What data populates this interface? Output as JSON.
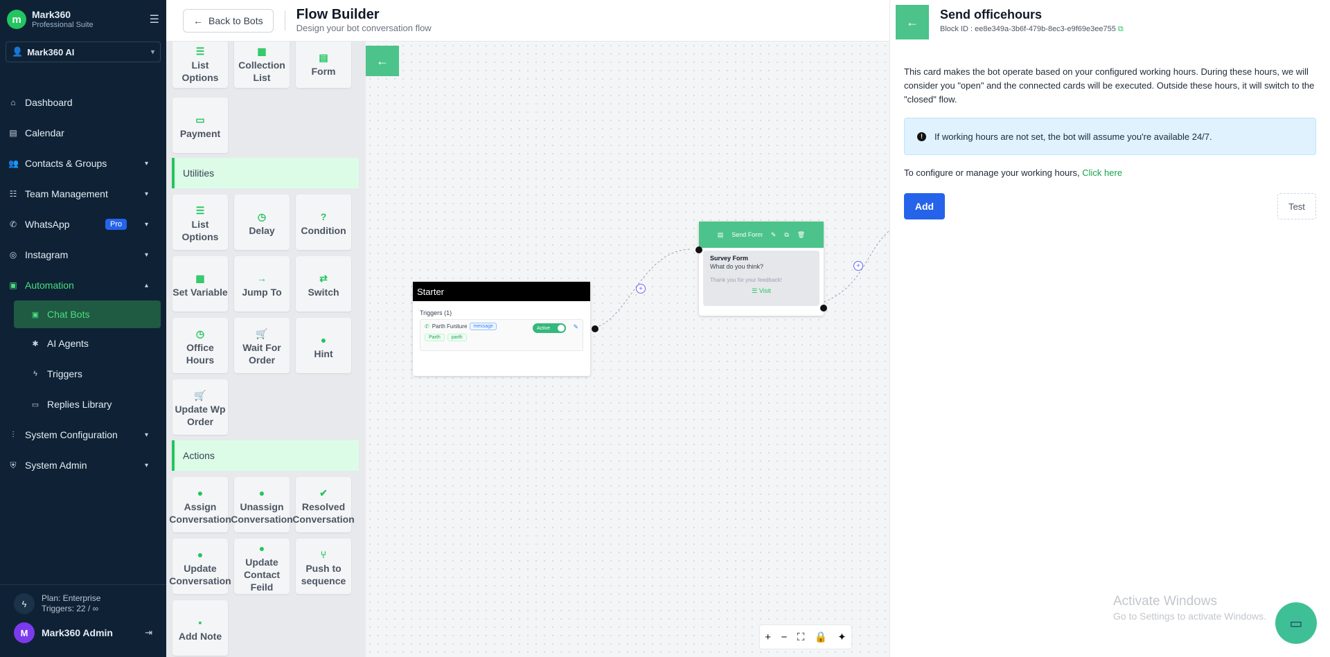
{
  "sidebar": {
    "brand": {
      "name": "Mark360",
      "subtitle": "Professional Suite",
      "logo_glyph": "m"
    },
    "workspace": "Mark360 AI",
    "items": [
      {
        "label": "Dashboard",
        "icon": "home-icon"
      },
      {
        "label": "Calendar",
        "icon": "calendar-icon"
      },
      {
        "label": "Contacts & Groups",
        "icon": "users-icon"
      },
      {
        "label": "Team Management",
        "icon": "team-icon"
      },
      {
        "label": "WhatsApp",
        "icon": "whatsapp-icon",
        "badge": "Pro"
      },
      {
        "label": "Instagram",
        "icon": "instagram-icon"
      },
      {
        "label": "Automation",
        "icon": "monitor-icon"
      },
      {
        "label": "System Configuration",
        "icon": "sliders-icon"
      },
      {
        "label": "System Admin",
        "icon": "shield-icon"
      }
    ],
    "sub_items": [
      {
        "label": "Chat Bots",
        "icon": "monitor-icon"
      },
      {
        "label": "AI Agents",
        "icon": "sparkle-icon"
      },
      {
        "label": "Triggers",
        "icon": "bolt-icon"
      },
      {
        "label": "Replies Library",
        "icon": "chat-icon"
      }
    ],
    "footer": {
      "plan": "Plan: Enterprise",
      "triggers": "Triggers: 22 / ∞",
      "user": "Mark360 Admin",
      "avatar": "M"
    }
  },
  "header": {
    "back_label": "Back to Bots",
    "title": "Flow Builder",
    "subtitle": "Design your bot conversation flow"
  },
  "palette": {
    "top_tiles": [
      "List Options",
      "Collection List",
      "Form",
      "Payment"
    ],
    "utilities_label": "Utilities",
    "utilities": [
      "List Options",
      "Delay",
      "Condition",
      "Set Variable",
      "Jump To",
      "Switch",
      "Office Hours",
      "Wait For Order",
      "Hint",
      "Update Wp Order"
    ],
    "actions_label": "Actions",
    "actions": [
      "Assign Conversation",
      "Unassign Conversation",
      "Resolved Conversation",
      "Update Conversation",
      "Update Contact Feild",
      "Push to sequence",
      "Add Note"
    ]
  },
  "canvas": {
    "starter": {
      "title": "Starter",
      "triggers_label": "Triggers (1)",
      "trigger_name": "Parth Funiture",
      "trigger_type": "message",
      "toggle": "Active",
      "tags": [
        "Parth",
        "parth"
      ]
    },
    "form_node": {
      "header": "Send Form",
      "title": "Survey Form",
      "question": "What do you think?",
      "thanks": "Thank you for your feedback!",
      "visit": "Visit"
    }
  },
  "panel": {
    "title": "Send officehours",
    "block_id_label": "Block ID :",
    "block_id": "ee8e349a-3b6f-479b-8ec3-e9f69e3ee755",
    "description": "This card makes the bot operate based on your configured working hours. During these hours, we will consider you \"open\" and the connected cards will be executed. Outside these hours, it will switch to the \"closed\" flow.",
    "info": "If working hours are not set, the bot will assume you're available 24/7.",
    "configure_text": "To configure or manage your working hours,",
    "configure_link": "Click here",
    "add_label": "Add",
    "test_label": "Test"
  },
  "watermark": {
    "line1": "Activate Windows",
    "line2": "Go to Settings to activate Windows."
  },
  "colors": {
    "sidebar_bg": "#0f2235",
    "accent": "#4cc38a",
    "primary_button": "#2563eb"
  }
}
